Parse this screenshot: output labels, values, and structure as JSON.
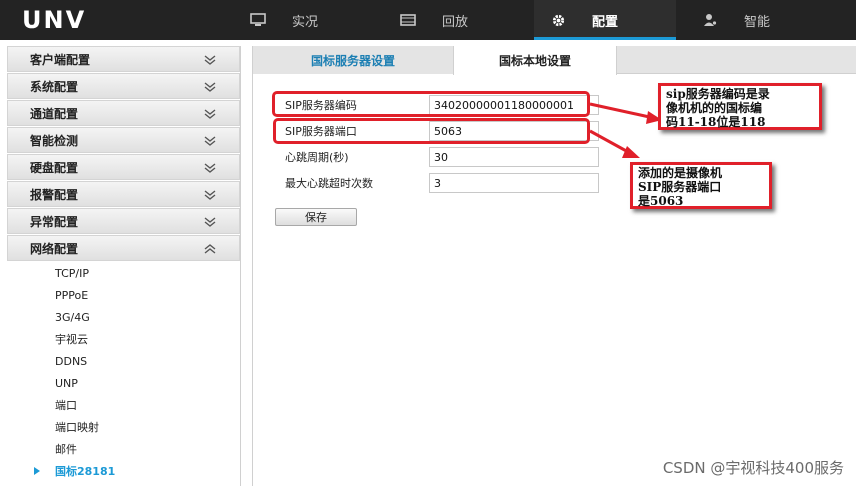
{
  "app": {
    "logo": "UNV"
  },
  "topnav": {
    "items": [
      {
        "label": "实况",
        "icon": "monitor-icon",
        "active": false
      },
      {
        "label": "回放",
        "icon": "film-icon",
        "active": false
      },
      {
        "label": "配置",
        "icon": "gear-icon",
        "active": true
      },
      {
        "label": "智能",
        "icon": "person-icon",
        "active": false
      }
    ]
  },
  "sidebar": {
    "sections": [
      {
        "label": "客户端配置",
        "state": "collapsed"
      },
      {
        "label": "系统配置",
        "state": "collapsed"
      },
      {
        "label": "通道配置",
        "state": "collapsed"
      },
      {
        "label": "智能检测",
        "state": "collapsed"
      },
      {
        "label": "硬盘配置",
        "state": "collapsed"
      },
      {
        "label": "报警配置",
        "state": "collapsed"
      },
      {
        "label": "异常配置",
        "state": "collapsed"
      },
      {
        "label": "网络配置",
        "state": "expanded"
      }
    ],
    "network_items": [
      "TCP/IP",
      "PPPoE",
      "3G/4G",
      "宇视云",
      "DDNS",
      "UNP",
      "端口",
      "端口映射",
      "邮件",
      "国标28181"
    ],
    "active_item": "国标28181"
  },
  "tabs": [
    {
      "label": "国标服务器设置",
      "active": false
    },
    {
      "label": "国标本地设置",
      "active": true
    }
  ],
  "form": {
    "fields": [
      {
        "label": "SIP服务器编码",
        "value": "34020000001180000001"
      },
      {
        "label": "SIP服务器端口",
        "value": "5063"
      },
      {
        "label": "心跳周期(秒)",
        "value": "30"
      },
      {
        "label": "最大心跳超时次数",
        "value": "3"
      }
    ],
    "save_label": "保存"
  },
  "annotations": {
    "callout1": [
      "sip服务器编码是录",
      "像机机的的国标编",
      "码11-18位是118"
    ],
    "callout2": [
      "添加的是摄像机",
      "SIP服务器端口",
      "是5063"
    ],
    "highlight_color": "#e0202a"
  },
  "watermark": "CSDN @宇视科技400服务",
  "colors": {
    "topbar": "#232323",
    "accent": "#1c9ad6"
  }
}
